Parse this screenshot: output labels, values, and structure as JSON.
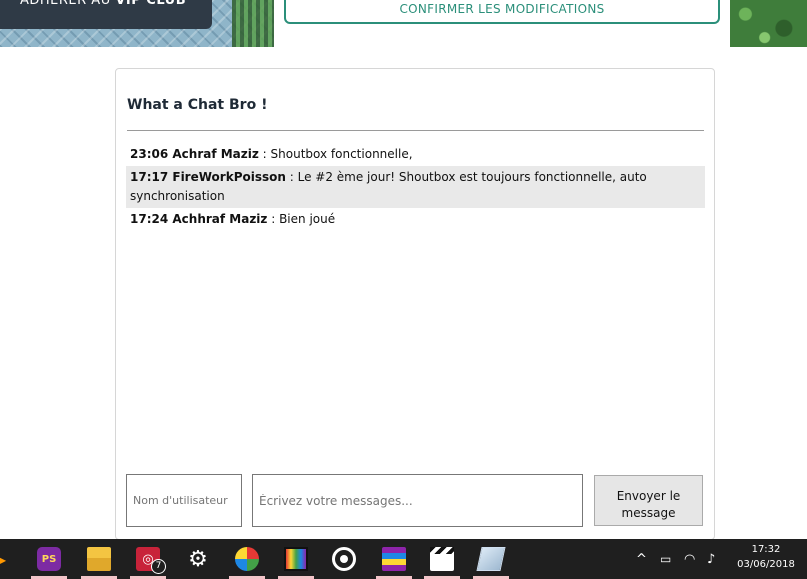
{
  "banner": {
    "vip_prefix": "ADHÉRER AU",
    "vip_bold": "VIP CLUB",
    "confirm_label": "CONFIRMER LES MODIFICATIONS"
  },
  "chat": {
    "title": "What a Chat Bro !",
    "messages": [
      {
        "meta": "23:06 Achraf Maziz",
        "text": " : Shoutbox fonctionnelle,"
      },
      {
        "meta": "17:17 FireWorkPoisson",
        "text": " : Le #2 ème jour! Shoutbox est toujours fonctionnelle, auto synchronisation"
      },
      {
        "meta": "17:24 Achhraf Maziz",
        "text": " : Bien joué"
      }
    ],
    "username_placeholder": "Nom d'utilisateur",
    "message_placeholder": "Écrivez votre messages...",
    "send_label": "Envoyer le message"
  },
  "taskbar": {
    "icons": [
      "flame-icon",
      "phpstorm-icon",
      "folder-icon",
      "instagram-icon",
      "gear-icon",
      "colorwheel-icon",
      "rainbow-icon",
      "target-icon",
      "winrar-icon",
      "clapperboard-icon",
      "glass-icon"
    ],
    "instagram_badge": "7",
    "time": "17:32",
    "date": "03/06/2018"
  }
}
